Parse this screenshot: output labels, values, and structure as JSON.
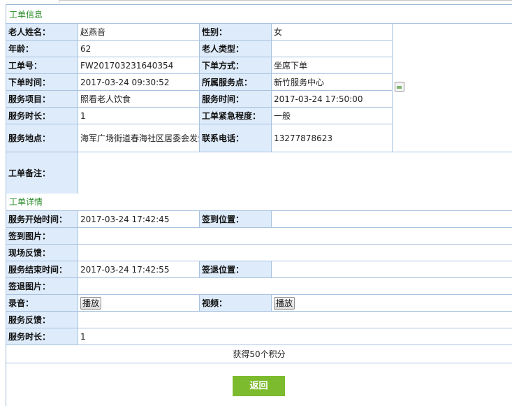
{
  "order_info": {
    "title": "工单信息",
    "elder_name_label": "老人姓名：",
    "elder_name": "赵燕音",
    "gender_label": "性别：",
    "gender": "女",
    "age_label": "年龄：",
    "age": "62",
    "elder_type_label": "老人类型：",
    "elder_type": "",
    "order_no_label": "工单号：",
    "order_no": "FW201703231640354",
    "order_method_label": "下单方式：",
    "order_method": "坐席下单",
    "order_time_label": "下单时间：",
    "order_time": "2017-03-24 09:30:52",
    "service_center_label": "所属服务点：",
    "service_center": "新竹服务中心",
    "service_item_label": "服务项目：",
    "service_item": "照看老人饮食",
    "service_time_label": "服务时间：",
    "service_time": "2017-03-24 17:50:00",
    "service_duration_label": "服务时长：",
    "service_duration": "1",
    "urgency_label": "工单紧急程度：",
    "urgency": "一般",
    "service_location_label": "服务地点：",
    "service_location": "海军广场街道春海社区居委会发士大夫",
    "phone_label": "联系电话：",
    "phone": "13277878623",
    "remark_label": "工单备注：",
    "remark": ""
  },
  "order_detail": {
    "title": "工单详情",
    "start_time_label": "服务开始时间：",
    "start_time": "2017-03-24 17:42:45",
    "checkin_location_label": "签到位置：",
    "checkin_location": "",
    "checkin_photo_label": "签到图片：",
    "onsite_feedback_label": "现场反馈：",
    "end_time_label": "服务结束时间：",
    "end_time": "2017-03-24 17:42:55",
    "checkout_location_label": "签退位置：",
    "checkout_location": "",
    "checkout_photo_label": "签退图片：",
    "audio_label": "录音：",
    "audio_play": "播放",
    "video_label": "视频：",
    "video_play": "播放",
    "service_feedback_label": "服务反馈：",
    "duration_label": "服务时长：",
    "duration": "1"
  },
  "points_text": "获得50个积分",
  "back_button": "返回"
}
